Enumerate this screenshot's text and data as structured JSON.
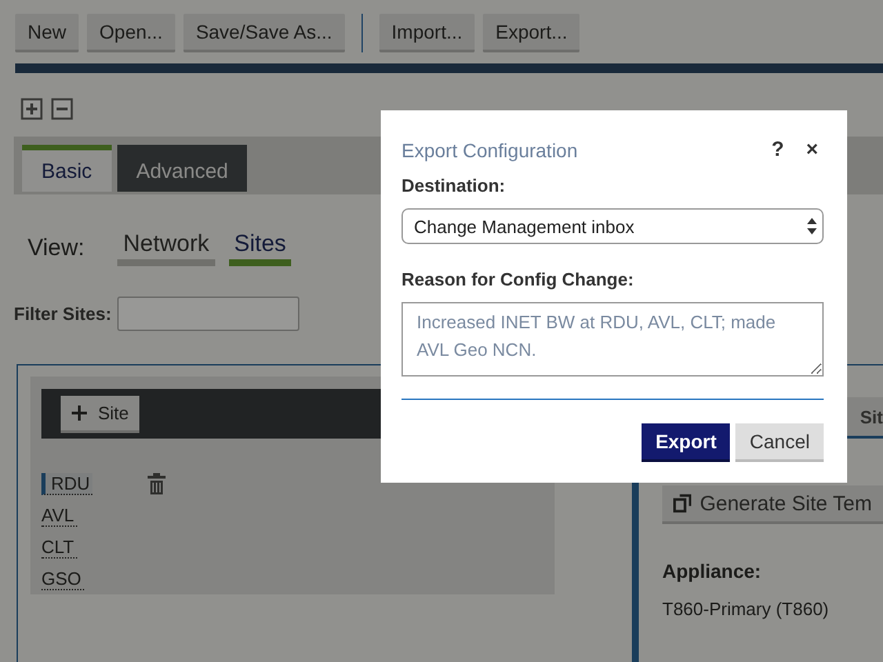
{
  "toolbar": {
    "groups": [
      [
        "New",
        "Open...",
        "Save/Save As..."
      ],
      [
        "Import...",
        "Export..."
      ]
    ]
  },
  "tabs": [
    {
      "label": "Basic",
      "selected": true
    },
    {
      "label": "Advanced",
      "selected": false
    }
  ],
  "view": {
    "label": "View:",
    "options": [
      {
        "label": "Network",
        "selected": false
      },
      {
        "label": "Sites",
        "selected": true
      }
    ]
  },
  "filter": {
    "label": "Filter Sites:"
  },
  "sites_panel": {
    "add_button": "Site",
    "sites": [
      {
        "name": "RDU",
        "selected": true
      },
      {
        "name": "AVL",
        "selected": false
      },
      {
        "name": "CLT",
        "selected": false
      },
      {
        "name": "GSO",
        "selected": false
      }
    ]
  },
  "site_detail": {
    "tab": "Sit",
    "button": "Generate Site Tem",
    "appliance_label": "Appliance:",
    "appliance_value": "T860-Primary (T860)"
  },
  "dialog": {
    "title": "Export Configuration",
    "help": "?",
    "close": "×",
    "destination_label": "Destination:",
    "destination_value": "Change Management inbox",
    "reason_label": "Reason for Config Change:",
    "reason_value": "Increased INET BW at RDU, AVL, CLT; made AVL Geo NCN.",
    "buttons": [
      {
        "label": "Export",
        "kind": "primary"
      },
      {
        "label": "Cancel",
        "kind": "secondary"
      }
    ]
  }
}
